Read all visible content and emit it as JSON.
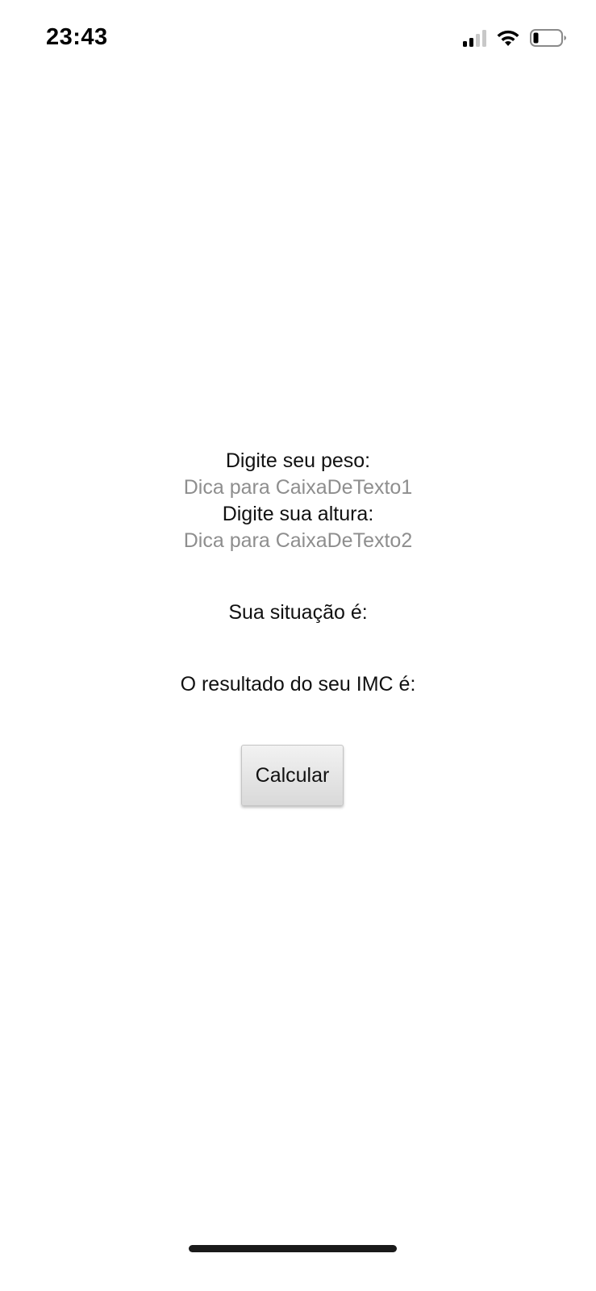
{
  "status_bar": {
    "time": "23:43",
    "icons": [
      "cellular-signal-icon",
      "wifi-icon",
      "battery-icon"
    ],
    "battery_level": 0.15,
    "signal_bars_active": 2,
    "signal_bars_total": 4
  },
  "form": {
    "weight_label": "Digite seu peso:",
    "weight_placeholder": "Dica para CaixaDeTexto1",
    "weight_value": "",
    "height_label": "Digite sua altura:",
    "height_placeholder": "Dica para CaixaDeTexto2",
    "height_value": ""
  },
  "results": {
    "situation_label": "Sua situação é:",
    "imc_label": "O resultado do seu IMC é:"
  },
  "actions": {
    "calculate_label": "Calcular"
  },
  "colors": {
    "placeholder": "#8e8e8e",
    "text": "#111111",
    "background": "#ffffff"
  }
}
